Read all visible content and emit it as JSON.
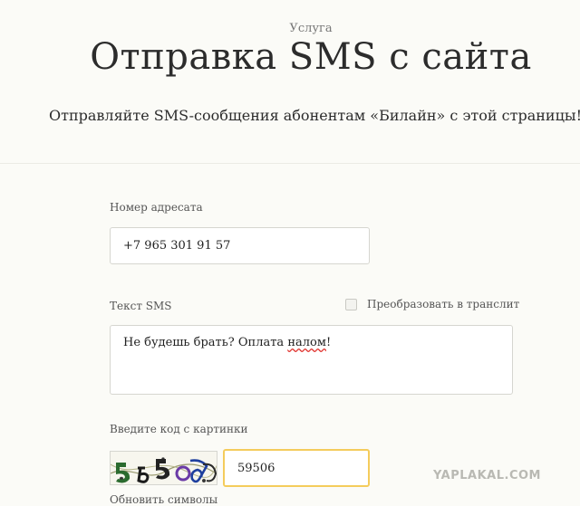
{
  "header": {
    "eyebrow": "Услуга",
    "title": "Отправка SMS с сайта",
    "subtitle": "Отправляйте SMS-сообщения абонентам «Билайн» с этой страницы!"
  },
  "form": {
    "phone": {
      "label": "Номер адресата",
      "value": "+7 965 301 91 57"
    },
    "sms": {
      "label": "Текст SMS",
      "translit_label": "Преобразовать в транслит",
      "translit_checked": false,
      "text_before": "Не будешь брать? Оплата ",
      "text_misspelled": "налом",
      "text_after": "!"
    },
    "captcha": {
      "label": "Введите код с картинки",
      "value": "59506",
      "refresh_label": "Обновить символы"
    }
  },
  "watermark": "YAPLAKAL.COM"
}
